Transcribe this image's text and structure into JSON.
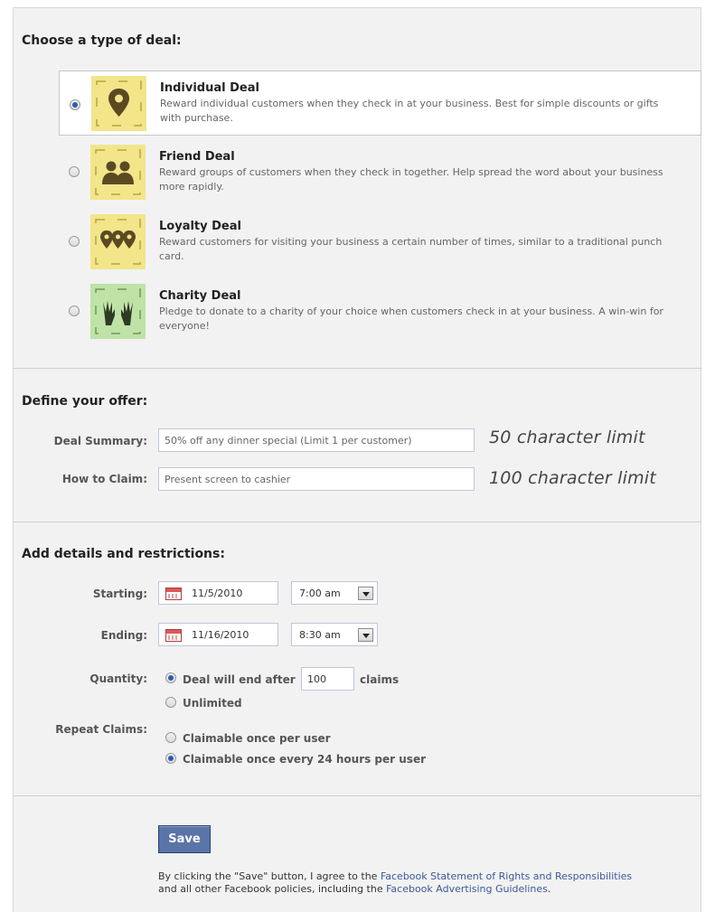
{
  "deal_type": {
    "heading": "Choose a type of deal:",
    "options": [
      {
        "title": "Individual Deal",
        "description": "Reward individual customers when they check in at your business. Best for simple discounts or gifts with purchase.",
        "icon": "map-pin-icon",
        "color": "#f2e58a",
        "selected": true
      },
      {
        "title": "Friend Deal",
        "description": "Reward groups of customers when they check in together. Help spread the word about your business more rapidly.",
        "icon": "group-people-icon",
        "color": "#f2e58a",
        "selected": false
      },
      {
        "title": "Loyalty Deal",
        "description": "Reward customers for visiting your business a certain number of times, similar to a traditional punch card.",
        "icon": "triple-pin-icon",
        "color": "#f2e58a",
        "selected": false
      },
      {
        "title": "Charity Deal",
        "description": "Pledge to donate to a charity of your choice when customers check in at your business. A win-win for everyone!",
        "icon": "raised-hands-icon",
        "color": "#bfe2a8",
        "selected": false
      }
    ]
  },
  "offer": {
    "heading": "Define your offer:",
    "summary_label": "Deal Summary:",
    "summary_value": "50% off any dinner special (Limit 1 per customer)",
    "summary_limit": "50 character limit",
    "claim_label": "How to Claim:",
    "claim_value": "Present screen to cashier",
    "claim_limit": "100 character limit"
  },
  "details": {
    "heading": "Add details and restrictions:",
    "starting_label": "Starting:",
    "starting_date": "11/5/2010",
    "starting_time": "7:00 am",
    "ending_label": "Ending:",
    "ending_date": "11/16/2010",
    "ending_time": "8:30 am",
    "quantity_label": "Quantity:",
    "quantity_end_prefix": "Deal will end after",
    "quantity_value": "100",
    "quantity_end_suffix": "claims",
    "quantity_unlimited": "Unlimited",
    "quantity_selected": "end_after",
    "repeat_label": "Repeat Claims:",
    "repeat_once": "Claimable once per user",
    "repeat_daily": "Claimable once every 24 hours per user",
    "repeat_selected": "daily"
  },
  "footer": {
    "save_label": "Save",
    "legal_prefix": "By clicking the \"Save\" button, I agree to the ",
    "legal_link1": "Facebook Statement of Rights and Responsibilities",
    "legal_middle": "and all other Facebook policies, including the ",
    "legal_link2": "Facebook Advertising Guidelines",
    "legal_suffix": "."
  },
  "colors": {
    "link": "#3b5998",
    "save_button": "#5b74a8",
    "radio_selected": "#2a5bb8"
  }
}
